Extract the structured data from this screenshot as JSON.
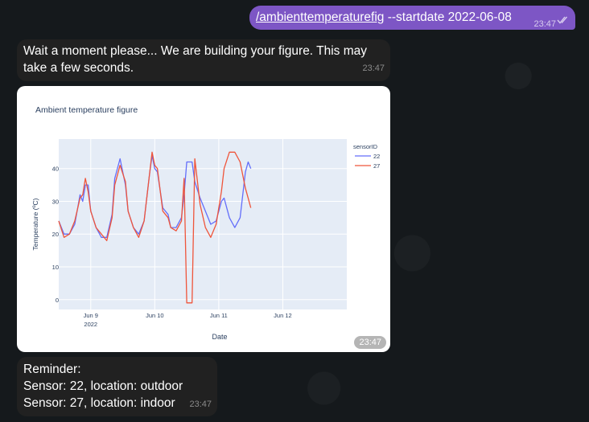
{
  "outgoing": {
    "command": "/ambienttemperaturefig",
    "args": " --startdate 2022-06-08",
    "time": "23:47"
  },
  "wait_message": {
    "text": "Wait a moment please... We are building your figure. This may take a few seconds.",
    "time": "23:47"
  },
  "figure_message": {
    "time": "23:47"
  },
  "reminder": {
    "line1": "Reminder:",
    "line2": "Sensor: 22, location: outdoor",
    "line3": "Sensor: 27, location: indoor",
    "time": "23:47"
  },
  "colors": {
    "outgoing_bubble": "#7d56c5",
    "incoming_bubble": "#212121",
    "series_22": "#636efa",
    "series_27": "#ef553b",
    "plot_bg": "#e5ecf6"
  },
  "chart_data": {
    "type": "line",
    "title": "Ambient temperature figure",
    "xlabel": "Date",
    "ylabel": "Temperature (ºC)",
    "x_range": [
      "2022-06-08 12:00",
      "2022-06-13 00:00"
    ],
    "ylim": [
      -3,
      49
    ],
    "x_ticks": [
      {
        "date": "2022-06-09 00:00",
        "label": "Jun 9",
        "sublabel": "2022"
      },
      {
        "date": "2022-06-10 00:00",
        "label": "Jun 10",
        "sublabel": ""
      },
      {
        "date": "2022-06-11 00:00",
        "label": "Jun 11",
        "sublabel": ""
      },
      {
        "date": "2022-06-12 00:00",
        "label": "Jun 12",
        "sublabel": ""
      }
    ],
    "y_ticks": [
      0,
      10,
      20,
      30,
      40
    ],
    "legend_title": "sensorID",
    "legend_position": "top-right",
    "grid": true,
    "series": [
      {
        "name": "22",
        "color": "#636efa",
        "points": [
          [
            "2022-06-08 12:00",
            24
          ],
          [
            "2022-06-08 14:00",
            20
          ],
          [
            "2022-06-08 16:00",
            20
          ],
          [
            "2022-06-08 18:00",
            23
          ],
          [
            "2022-06-08 20:00",
            32
          ],
          [
            "2022-06-08 21:00",
            30
          ],
          [
            "2022-06-08 22:00",
            35
          ],
          [
            "2022-06-08 23:00",
            35
          ],
          [
            "2022-06-09 00:00",
            27
          ],
          [
            "2022-06-09 02:00",
            22
          ],
          [
            "2022-06-09 04:00",
            19
          ],
          [
            "2022-06-09 06:00",
            19
          ],
          [
            "2022-06-09 08:00",
            26
          ],
          [
            "2022-06-09 09:00",
            37
          ],
          [
            "2022-06-09 11:00",
            43
          ],
          [
            "2022-06-09 13:00",
            35
          ],
          [
            "2022-06-09 14:00",
            27
          ],
          [
            "2022-06-09 16:00",
            22
          ],
          [
            "2022-06-09 18:00",
            20
          ],
          [
            "2022-06-09 20:00",
            24
          ],
          [
            "2022-06-09 22:00",
            38
          ],
          [
            "2022-06-09 23:00",
            44
          ],
          [
            "2022-06-10 00:00",
            40
          ],
          [
            "2022-06-10 01:00",
            39
          ],
          [
            "2022-06-10 03:00",
            28
          ],
          [
            "2022-06-10 05:00",
            26
          ],
          [
            "2022-06-10 06:00",
            22
          ],
          [
            "2022-06-10 08:00",
            22
          ],
          [
            "2022-06-10 10:00",
            25
          ],
          [
            "2022-06-10 11:00",
            32
          ],
          [
            "2022-06-10 12:00",
            42
          ],
          [
            "2022-06-10 14:00",
            42
          ],
          [
            "2022-06-10 15:00",
            36
          ],
          [
            "2022-06-10 17:00",
            31
          ],
          [
            "2022-06-10 19:00",
            27
          ],
          [
            "2022-06-10 21:00",
            23
          ],
          [
            "2022-06-10 23:00",
            24
          ],
          [
            "2022-06-11 01:00",
            30
          ],
          [
            "2022-06-11 02:00",
            31
          ],
          [
            "2022-06-11 04:00",
            25
          ],
          [
            "2022-06-11 06:00",
            22
          ],
          [
            "2022-06-11 08:00",
            25
          ],
          [
            "2022-06-11 10:00",
            39
          ],
          [
            "2022-06-11 11:00",
            42
          ],
          [
            "2022-06-11 12:00",
            40
          ]
        ]
      },
      {
        "name": "27",
        "color": "#ef553b",
        "points": [
          [
            "2022-06-08 12:00",
            24
          ],
          [
            "2022-06-08 14:00",
            19
          ],
          [
            "2022-06-08 16:00",
            20
          ],
          [
            "2022-06-08 18:00",
            24
          ],
          [
            "2022-06-08 20:00",
            31
          ],
          [
            "2022-06-08 21:00",
            32
          ],
          [
            "2022-06-08 22:00",
            37
          ],
          [
            "2022-06-08 23:00",
            33
          ],
          [
            "2022-06-09 00:00",
            27
          ],
          [
            "2022-06-09 02:00",
            22
          ],
          [
            "2022-06-09 04:00",
            20
          ],
          [
            "2022-06-09 06:00",
            18
          ],
          [
            "2022-06-09 08:00",
            25
          ],
          [
            "2022-06-09 09:00",
            35
          ],
          [
            "2022-06-09 11:00",
            41
          ],
          [
            "2022-06-09 13:00",
            36
          ],
          [
            "2022-06-09 14:00",
            27
          ],
          [
            "2022-06-09 16:00",
            22
          ],
          [
            "2022-06-09 18:00",
            19
          ],
          [
            "2022-06-09 20:00",
            24
          ],
          [
            "2022-06-09 22:00",
            38
          ],
          [
            "2022-06-09 23:00",
            45
          ],
          [
            "2022-06-10 00:00",
            41
          ],
          [
            "2022-06-10 01:00",
            40
          ],
          [
            "2022-06-10 03:00",
            27
          ],
          [
            "2022-06-10 05:00",
            25
          ],
          [
            "2022-06-10 06:00",
            22
          ],
          [
            "2022-06-10 08:00",
            21
          ],
          [
            "2022-06-10 10:00",
            24
          ],
          [
            "2022-06-10 11:00",
            37
          ],
          [
            "2022-06-10 12:00",
            -1
          ],
          [
            "2022-06-10 14:00",
            -1
          ],
          [
            "2022-06-10 15:00",
            43
          ],
          [
            "2022-06-10 17:00",
            29
          ],
          [
            "2022-06-10 19:00",
            22
          ],
          [
            "2022-06-10 21:00",
            19
          ],
          [
            "2022-06-10 23:00",
            23
          ],
          [
            "2022-06-11 01:00",
            33
          ],
          [
            "2022-06-11 02:00",
            40
          ],
          [
            "2022-06-11 04:00",
            45
          ],
          [
            "2022-06-11 06:00",
            45
          ],
          [
            "2022-06-11 08:00",
            42
          ],
          [
            "2022-06-11 10:00",
            34
          ],
          [
            "2022-06-11 11:00",
            31
          ],
          [
            "2022-06-11 12:00",
            28
          ]
        ]
      }
    ]
  }
}
